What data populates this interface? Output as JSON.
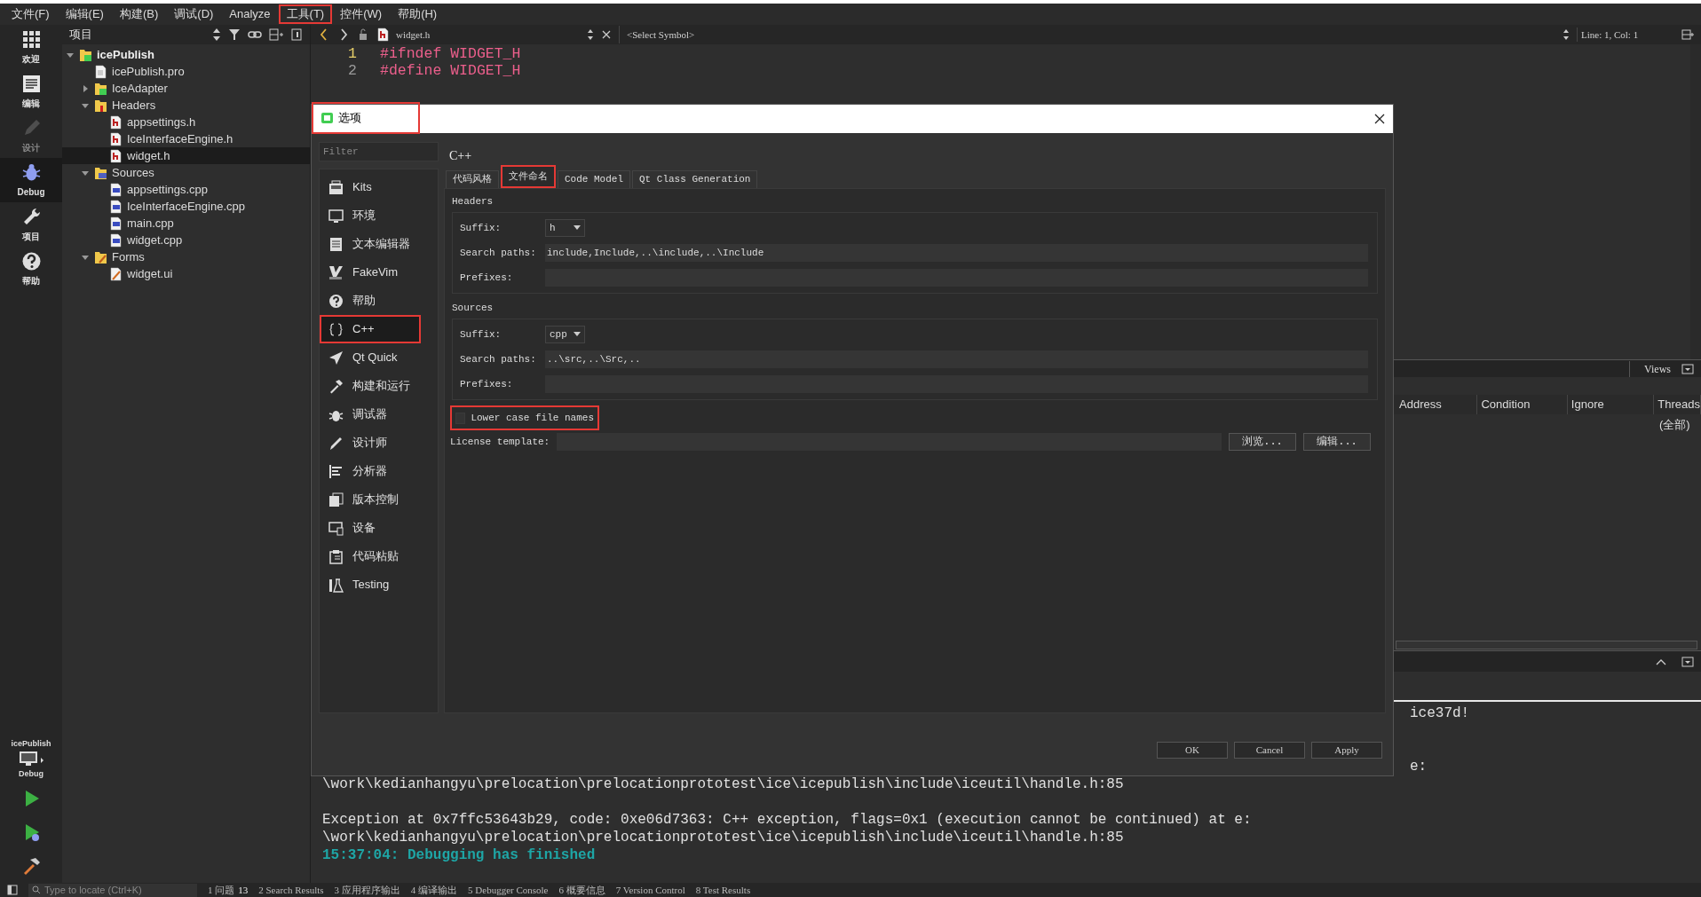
{
  "menu_bar": [
    {
      "label": "文件(F)",
      "highlighted": false
    },
    {
      "label": "编辑(E)",
      "highlighted": false
    },
    {
      "label": "构建(B)",
      "highlighted": false
    },
    {
      "label": "调试(D)",
      "highlighted": false
    },
    {
      "label": "Analyze",
      "highlighted": false
    },
    {
      "label": "工具(T)",
      "highlighted": true
    },
    {
      "label": "控件(W)",
      "highlighted": false
    },
    {
      "label": "帮助(H)",
      "highlighted": false
    }
  ],
  "mode_bar": {
    "items": [
      {
        "label": "欢迎",
        "selected": false
      },
      {
        "label": "编辑",
        "selected": false
      },
      {
        "label": "设计",
        "selected": false,
        "disabled": true
      },
      {
        "label": "Debug",
        "selected": true
      },
      {
        "label": "项目",
        "selected": false
      },
      {
        "label": "帮助",
        "selected": false
      }
    ],
    "project": "icePublish",
    "config": "Debug"
  },
  "project_panel": {
    "title": "项目",
    "tree": [
      {
        "label": "icePublish",
        "kind": "project",
        "expanded": true,
        "selected": false,
        "children": [
          {
            "label": "icePublish.pro",
            "kind": "pro",
            "selected": false
          },
          {
            "label": "IceAdapter",
            "kind": "subproject",
            "expanded": false,
            "selected": false
          },
          {
            "label": "Headers",
            "kind": "headers",
            "expanded": true,
            "selected": false,
            "children": [
              {
                "label": "appsettings.h",
                "kind": "header",
                "selected": false
              },
              {
                "label": "IceInterfaceEngine.h",
                "kind": "header",
                "selected": false
              },
              {
                "label": "widget.h",
                "kind": "header",
                "selected": true
              }
            ]
          },
          {
            "label": "Sources",
            "kind": "sources",
            "expanded": true,
            "selected": false,
            "children": [
              {
                "label": "appsettings.cpp",
                "kind": "source",
                "selected": false
              },
              {
                "label": "IceInterfaceEngine.cpp",
                "kind": "source",
                "selected": false
              },
              {
                "label": "main.cpp",
                "kind": "source",
                "selected": false
              },
              {
                "label": "widget.cpp",
                "kind": "source",
                "selected": false
              }
            ]
          },
          {
            "label": "Forms",
            "kind": "forms",
            "expanded": true,
            "selected": false,
            "children": [
              {
                "label": "widget.ui",
                "kind": "form",
                "selected": false
              }
            ]
          }
        ]
      }
    ]
  },
  "editor": {
    "file": "widget.h",
    "symbol": "<Select Symbol>",
    "position": "Line: 1, Col: 1",
    "lines": [
      {
        "number": "1",
        "text": "#ifndef WIDGET_H",
        "current": true
      },
      {
        "number": "2",
        "text": "#define WIDGET_H",
        "current": false
      }
    ]
  },
  "breakpoints": {
    "views": "Views",
    "columns": [
      "Address",
      "Condition",
      "Ignore",
      "Threads"
    ],
    "rows": [
      {
        "threads": "(全部)"
      }
    ]
  },
  "output": {
    "lines": [
      {
        "kind": "fragment",
        "text": "ice37d!"
      },
      {
        "kind": "blank"
      },
      {
        "kind": "blank"
      },
      {
        "kind": "fragment",
        "text": "e:"
      },
      {
        "kind": "plain",
        "text": "\\work\\kedianhangyu\\prelocation\\prelocationprototest\\ice\\icepublish\\include\\iceutil\\handle.h:85"
      },
      {
        "kind": "blank"
      },
      {
        "kind": "plain",
        "text": "Exception at 0x7ffc53643b29, code: 0xe06d7363: C++ exception, flags=0x1 (execution cannot be continued) at e:"
      },
      {
        "kind": "plain",
        "text": "\\work\\kedianhangyu\\prelocation\\prelocationprototest\\ice\\icepublish\\include\\iceutil\\handle.h:85"
      },
      {
        "kind": "status",
        "text": "15:37:04: Debugging has finished"
      }
    ]
  },
  "dialog": {
    "title": "选项",
    "title_highlighted": true,
    "filter_placeholder": "Filter",
    "page_title": "C++",
    "categories": [
      {
        "label": "Kits",
        "selected": false,
        "highlighted": false
      },
      {
        "label": "环境",
        "selected": false,
        "highlighted": false
      },
      {
        "label": "文本编辑器",
        "selected": false,
        "highlighted": false
      },
      {
        "label": "FakeVim",
        "selected": false,
        "highlighted": false
      },
      {
        "label": "帮助",
        "selected": false,
        "highlighted": false
      },
      {
        "label": "C++",
        "selected": true,
        "highlighted": true
      },
      {
        "label": "Qt Quick",
        "selected": false,
        "highlighted": false
      },
      {
        "label": "构建和运行",
        "selected": false,
        "highlighted": false
      },
      {
        "label": "调试器",
        "selected": false,
        "highlighted": false
      },
      {
        "label": "设计师",
        "selected": false,
        "highlighted": false
      },
      {
        "label": "分析器",
        "selected": false,
        "highlighted": false
      },
      {
        "label": "版本控制",
        "selected": false,
        "highlighted": false
      },
      {
        "label": "设备",
        "selected": false,
        "highlighted": false
      },
      {
        "label": "代码粘贴",
        "selected": false,
        "highlighted": false
      },
      {
        "label": "Testing",
        "selected": false,
        "highlighted": false
      }
    ],
    "tabs": [
      {
        "label": "代码风格",
        "selected": false,
        "highlighted": false
      },
      {
        "label": "文件命名",
        "selected": true,
        "highlighted": true
      },
      {
        "label": "Code Model",
        "selected": false,
        "highlighted": false
      },
      {
        "label": "Qt Class Generation",
        "selected": false,
        "highlighted": false
      }
    ],
    "groups": [
      {
        "title": "Headers",
        "suffix_label": "Suffix:",
        "suffix": "h",
        "search_label": "Search paths:",
        "search_paths": "include,Include,..\\include,..\\Include",
        "prefixes_label": "Prefixes:"
      },
      {
        "title": "Sources",
        "suffix_label": "Suffix:",
        "suffix": "cpp",
        "search_label": "Search paths:",
        "search_paths": "..\\src,..\\Src,..",
        "prefixes_label": "Prefixes:"
      }
    ],
    "lower_case": {
      "label": "Lower case file names",
      "checked": false,
      "highlighted": true
    },
    "license": {
      "label": "License template:",
      "buttons": [
        "浏览...",
        "编辑..."
      ]
    },
    "buttons": [
      "OK",
      "Cancel",
      "Apply"
    ]
  },
  "status_bar": {
    "locate_placeholder": "Type to locate (Ctrl+K)",
    "panes": [
      {
        "label": "1 问题",
        "count": "13"
      },
      {
        "label": "2 Search Results"
      },
      {
        "label": "3 应用程序输出"
      },
      {
        "label": "4 编译输出"
      },
      {
        "label": "5 Debugger Console"
      },
      {
        "label": "6 概要信息"
      },
      {
        "label": "7 Version Control"
      },
      {
        "label": "8 Test Results"
      }
    ]
  }
}
